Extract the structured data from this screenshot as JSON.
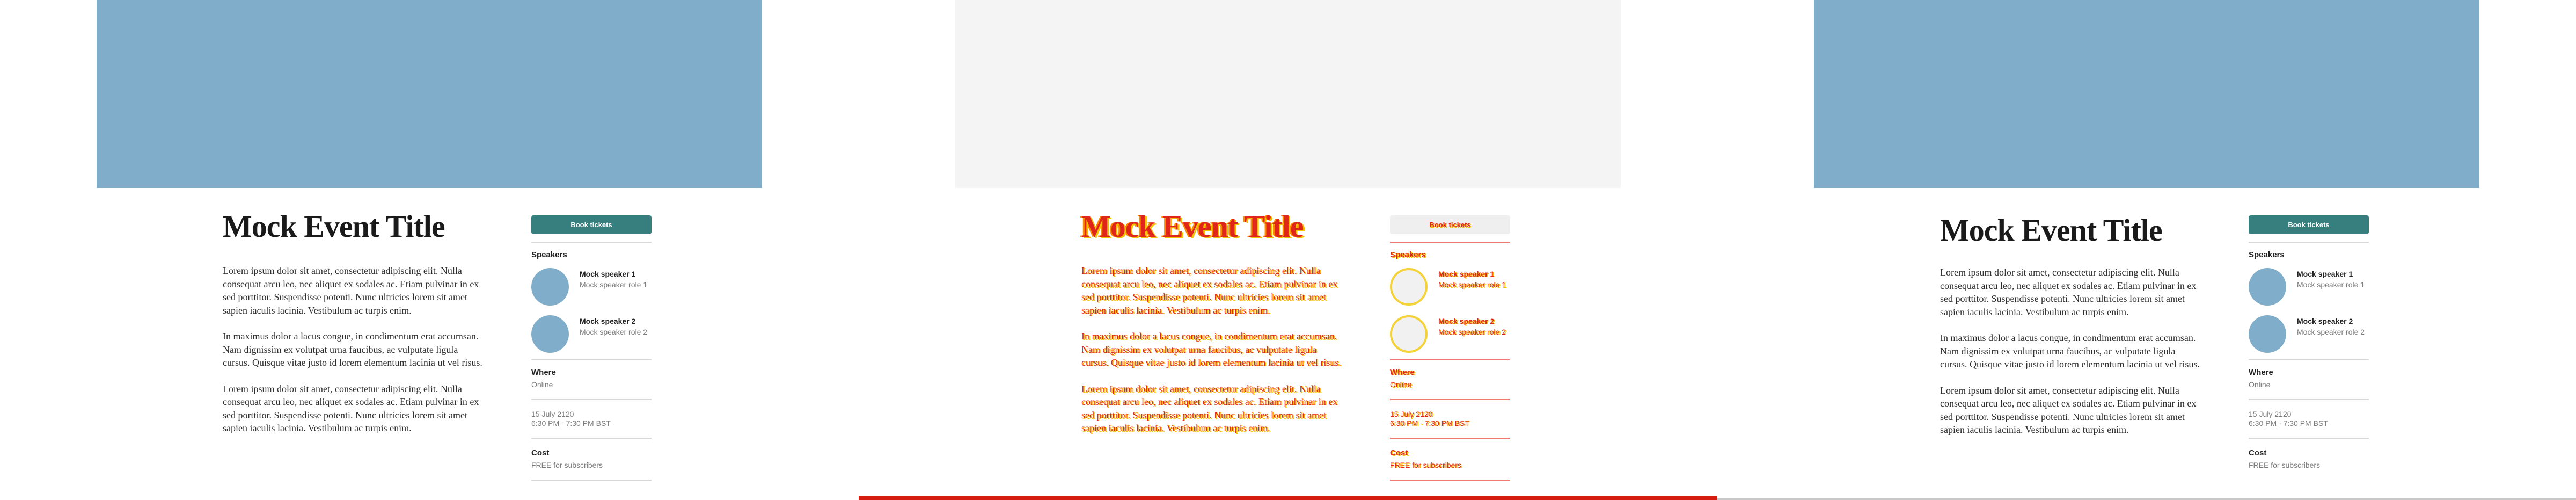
{
  "event": {
    "title": "Mock Event Title",
    "paragraphs": [
      "Lorem ipsum dolor sit amet, consectetur adipiscing elit. Nulla consequat arcu leo, nec aliquet ex sodales ac. Etiam pulvinar in ex sed porttitor. Suspendisse potenti. Nunc ultricies lorem sit amet sapien iaculis lacinia. Vestibulum ac turpis enim.",
      "In maximus dolor a lacus congue, in condimentum erat accumsan. Nam dignissim ex volutpat urna faucibus, ac vulputate ligula cursus. Quisque vitae justo id lorem elementum lacinia ut vel risus.",
      "Lorem ipsum dolor sit amet, consectetur adipiscing elit. Nulla consequat arcu leo, nec aliquet ex sodales ac. Etiam pulvinar in ex sed porttitor. Suspendisse potenti. Nunc ultricies lorem sit amet sapien iaculis lacinia. Vestibulum ac turpis enim."
    ]
  },
  "sidebar": {
    "book_label": "Book tickets",
    "speakers_heading": "Speakers",
    "speakers": [
      {
        "name": "Mock speaker 1",
        "role": "Mock speaker role 1"
      },
      {
        "name": "Mock speaker 2",
        "role": "Mock speaker role 2"
      }
    ],
    "where_label": "Where",
    "where_value": "Online",
    "date": "15 July 2120",
    "time": "6:30 PM - 7:30 PM BST",
    "cost_label": "Cost",
    "cost_value": "FREE for subscribers"
  },
  "colors": {
    "hero": "#80aeca",
    "button": "#377f7e",
    "diff_red": "#e0261a",
    "diff_yellow": "#f4c200"
  }
}
